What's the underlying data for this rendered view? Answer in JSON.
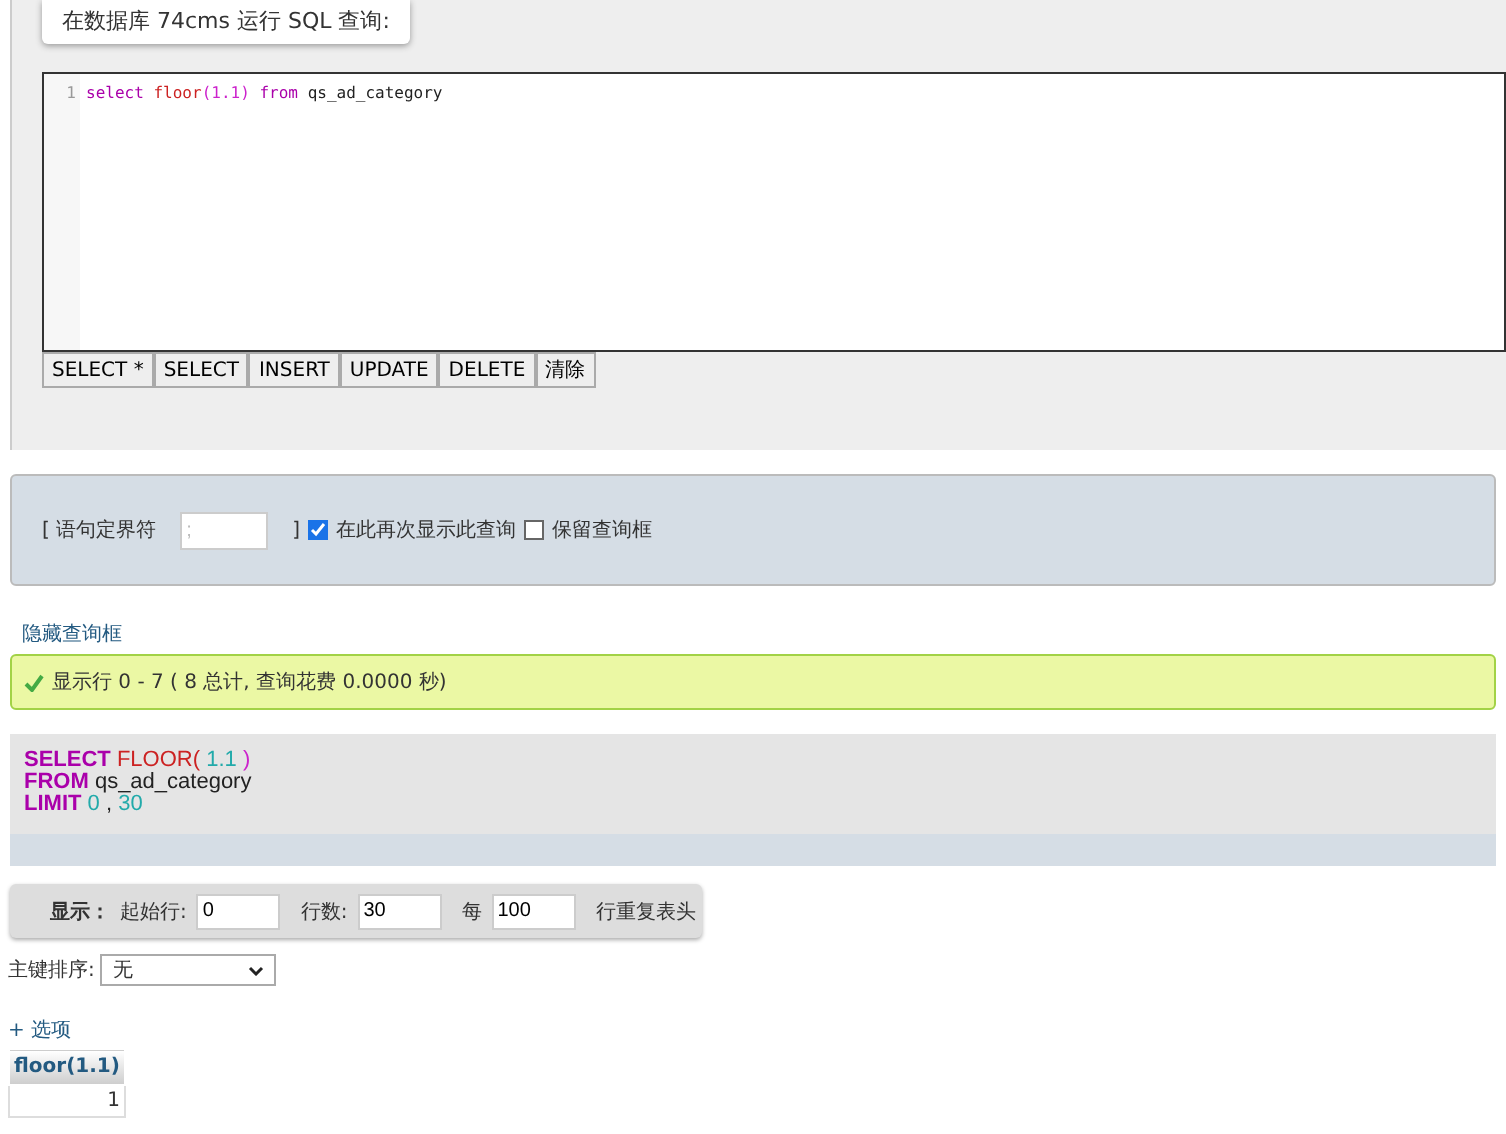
{
  "query_box": {
    "title": "在数据库 74cms 运行 SQL 查询:",
    "line_numbers": [
      "1"
    ],
    "code_tokens": [
      {
        "kind": "keyword",
        "text": "select"
      },
      {
        "kind": "function",
        "text": "floor"
      },
      {
        "kind": "paren",
        "text": "(1.1)"
      },
      {
        "kind": "keyword",
        "text": "from"
      },
      {
        "kind": "plain",
        "text": "qs_ad_category"
      }
    ],
    "buttons": [
      "SELECT *",
      "SELECT",
      "INSERT",
      "UPDATE",
      "DELETE",
      "清除"
    ]
  },
  "options": {
    "delimiter_open": "[ 语句定界符",
    "delimiter_value": ";",
    "delimiter_close": "]",
    "checkboxes": [
      {
        "label": "在此再次显示此查询",
        "checked": true
      },
      {
        "label": "保留查询框",
        "checked": false
      }
    ]
  },
  "hide_link": "隐藏查询框",
  "success_message": "显示行 0 - 7 ( 8 总计, 查询花费 0.0000 秒)",
  "formatted_sql": [
    [
      {
        "kind": "keyword",
        "text": "SELECT"
      },
      {
        "kind": "function",
        "text": "FLOOR("
      },
      {
        "kind": "number",
        "text": "1.1"
      },
      {
        "kind": "paren",
        "text": ")"
      }
    ],
    [
      {
        "kind": "keyword",
        "text": "FROM"
      },
      {
        "kind": "plain",
        "text": "qs_ad_category"
      }
    ],
    [
      {
        "kind": "keyword",
        "text": "LIMIT"
      },
      {
        "kind": "number",
        "text": "0"
      },
      {
        "kind": "plain",
        "text": ","
      },
      {
        "kind": "number",
        "text": "30"
      }
    ]
  ],
  "navigation": {
    "show_label": "显示：",
    "fields": [
      {
        "label": "起始行:",
        "value": "0"
      },
      {
        "label": "行数:",
        "value": "30"
      },
      {
        "label": "每",
        "value": "100"
      }
    ],
    "trailing_label": "行重复表头"
  },
  "sort": {
    "label": "主键排序:",
    "value": "无"
  },
  "options_link": "+ 选项",
  "table": {
    "columns": [
      "floor(1.1)"
    ],
    "rows": [
      [
        "1"
      ]
    ]
  }
}
